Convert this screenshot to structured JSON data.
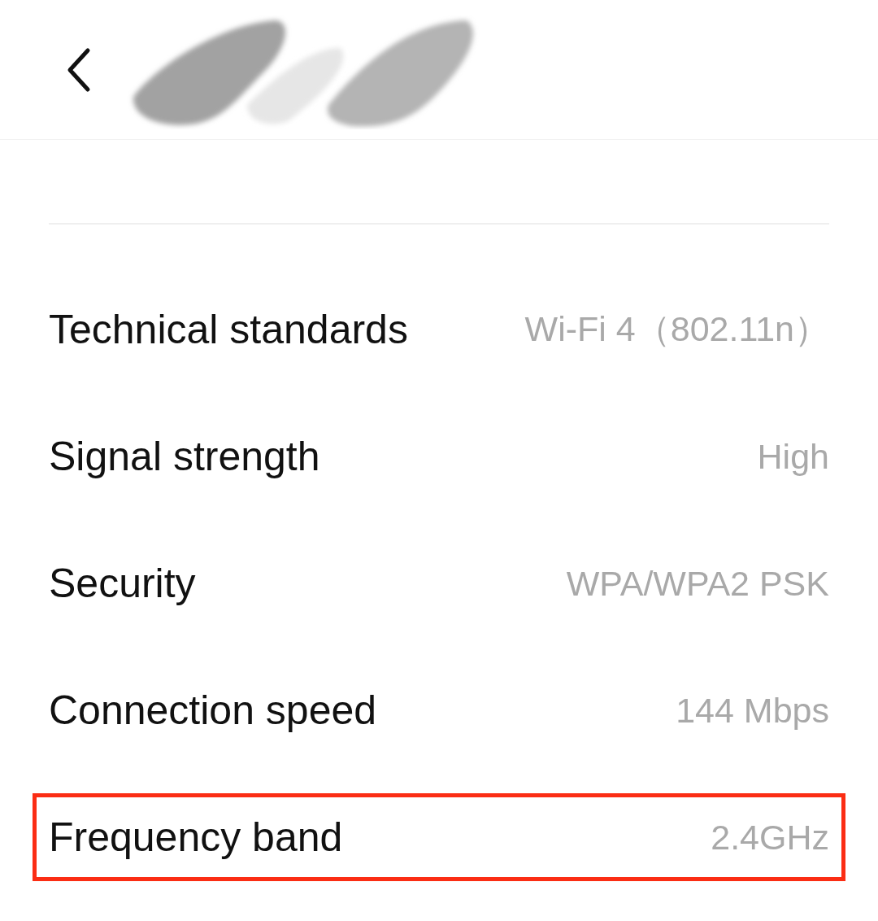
{
  "header": {
    "title_redacted": true
  },
  "details": [
    {
      "label": "Technical standards",
      "value": "Wi-Fi 4（802.11n）",
      "highlighted": false
    },
    {
      "label": "Signal strength",
      "value": "High",
      "highlighted": false
    },
    {
      "label": "Security",
      "value": "WPA/WPA2 PSK",
      "highlighted": false
    },
    {
      "label": "Connection speed",
      "value": "144 Mbps",
      "highlighted": false
    },
    {
      "label": "Frequency band",
      "value": "2.4GHz",
      "highlighted": true
    }
  ]
}
